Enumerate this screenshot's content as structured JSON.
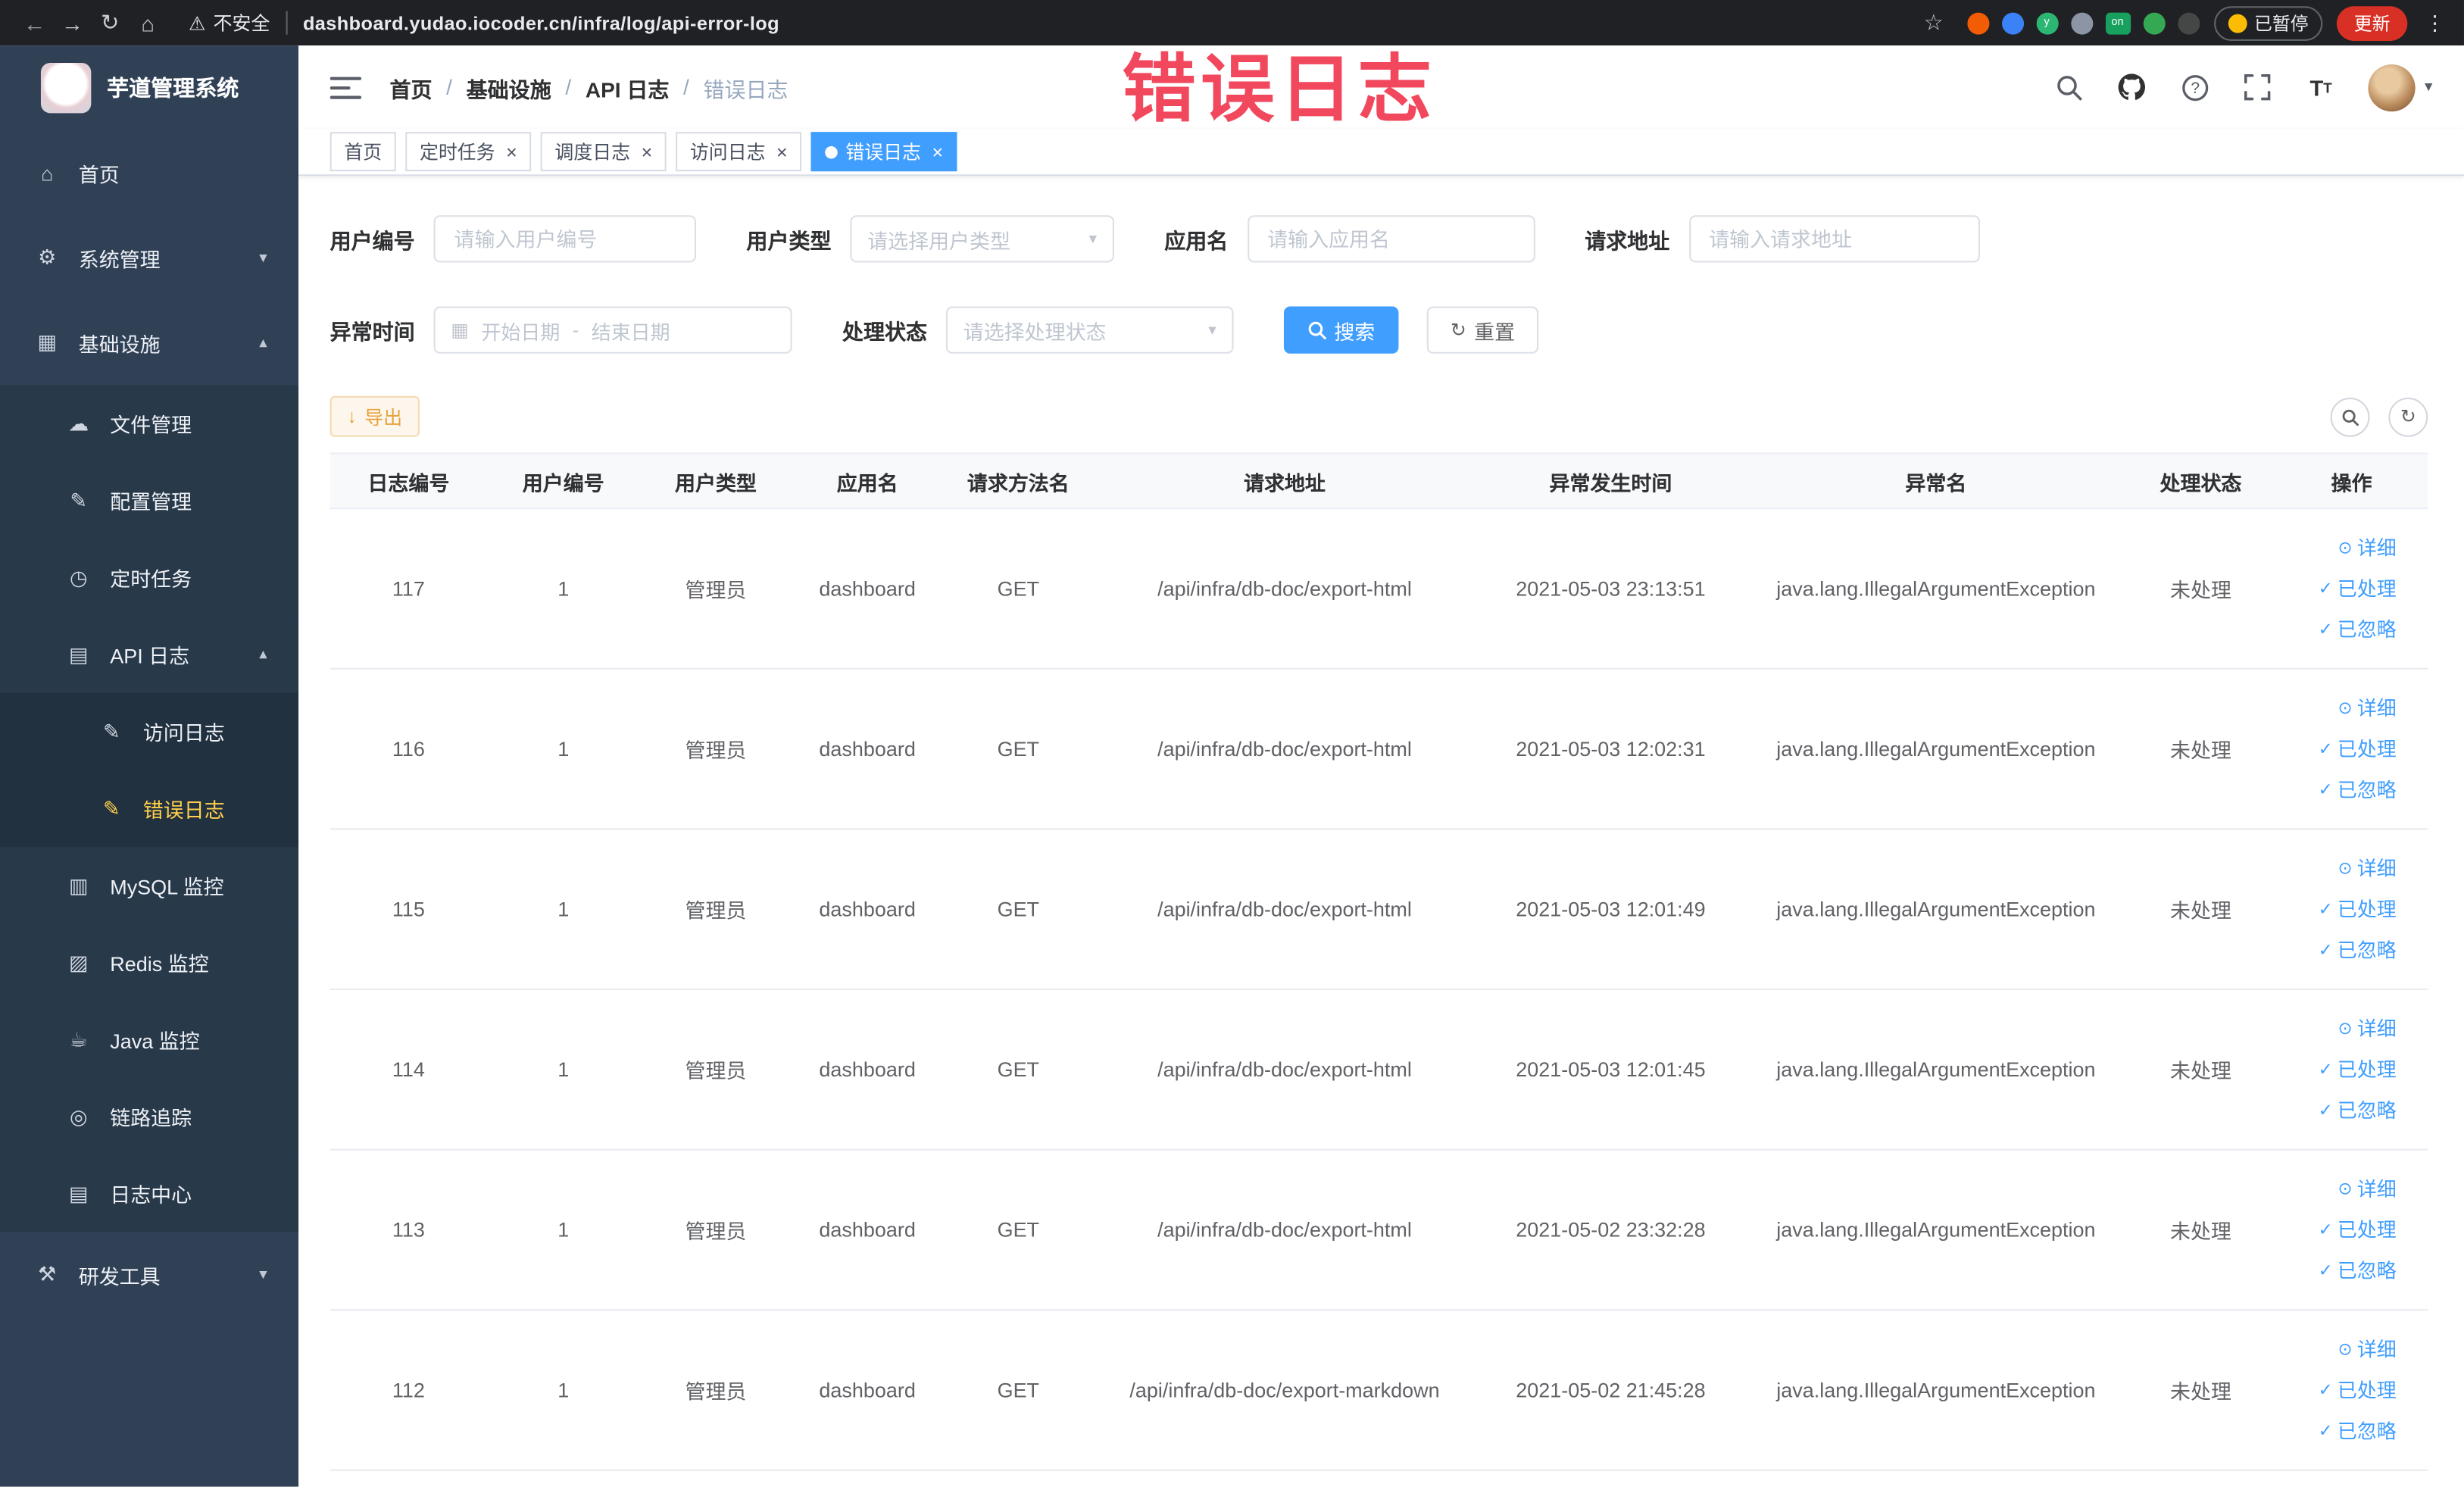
{
  "watermark": "错误日志",
  "icons": {
    "back": "←",
    "forward": "→",
    "reload": "↻",
    "home": "⌂",
    "warning": "⚠",
    "star": "☆",
    "menu_dots": "⋮",
    "close": "×",
    "chevron_down": "▾",
    "chevron_up": "▴",
    "caret_down": "▾",
    "check": "✓",
    "eye": "⊙",
    "calendar": "▦",
    "refresh": "↻",
    "download": "↓"
  },
  "browser": {
    "security_warning": "不安全",
    "url": "dashboard.yudao.iocoder.cn/infra/log/api-error-log",
    "paused_badge": "已暂停",
    "update_button": "更新",
    "extensions": [
      {
        "name": "orange",
        "color": "#f25c05",
        "text": ""
      },
      {
        "name": "blue-drop",
        "color": "#3b82f6",
        "text": ""
      },
      {
        "name": "green-y",
        "color": "#2bb673",
        "text": "y"
      },
      {
        "name": "grid",
        "color": "#8b95a5",
        "text": ""
      },
      {
        "name": "on-badge",
        "color": "#17a05e",
        "text": "on",
        "rect": true
      },
      {
        "name": "leaf",
        "color": "#34a853",
        "text": ""
      },
      {
        "name": "dark",
        "color": "#444746",
        "text": ""
      }
    ]
  },
  "sidebar": {
    "app_title": "芋道管理系统",
    "menu": [
      {
        "key": "home",
        "label": "首页",
        "icon": "home-icon",
        "glyph": "⌂",
        "level": 1
      },
      {
        "key": "system-management",
        "label": "系统管理",
        "icon": "gear-icon",
        "glyph": "⚙",
        "level": 1,
        "expandable": true,
        "expanded": false
      },
      {
        "key": "infrastructure",
        "label": "基础设施",
        "icon": "monitor-icon",
        "glyph": "▦",
        "level": 1,
        "expandable": true,
        "expanded": true
      },
      {
        "key": "file-management",
        "label": "文件管理",
        "icon": "cloud-icon",
        "glyph": "☁",
        "level": 2
      },
      {
        "key": "config-management",
        "label": "配置管理",
        "icon": "edit-icon",
        "glyph": "✎",
        "level": 2
      },
      {
        "key": "cron-job",
        "label": "定时任务",
        "icon": "clock-icon",
        "glyph": "◷",
        "level": 2
      },
      {
        "key": "api-log",
        "label": "API 日志",
        "icon": "log-icon",
        "glyph": "▤",
        "level": 2,
        "expandable": true,
        "expanded": true
      },
      {
        "key": "access-log",
        "label": "访问日志",
        "icon": "document-icon",
        "glyph": "✎",
        "level": 3
      },
      {
        "key": "error-log",
        "label": "错误日志",
        "icon": "document-icon",
        "glyph": "✎",
        "level": 3,
        "active": true
      },
      {
        "key": "mysql-monitor",
        "label": "MySQL 监控",
        "icon": "database-icon",
        "glyph": "▥",
        "level": 2
      },
      {
        "key": "redis-monitor",
        "label": "Redis 监控",
        "icon": "database-icon",
        "glyph": "▨",
        "level": 2
      },
      {
        "key": "java-monitor",
        "label": "Java 监控",
        "icon": "coffee-icon",
        "glyph": "☕",
        "level": 2
      },
      {
        "key": "link-trace",
        "label": "链路追踪",
        "icon": "trace-icon",
        "glyph": "◎",
        "level": 2
      },
      {
        "key": "log-center",
        "label": "日志中心",
        "icon": "log-icon",
        "glyph": "▤",
        "level": 2
      },
      {
        "key": "dev-tools",
        "label": "研发工具",
        "icon": "hammer-icon",
        "glyph": "⚒",
        "level": 1,
        "expandable": true,
        "expanded": false
      }
    ]
  },
  "header": {
    "breadcrumb": [
      "首页",
      "基础设施",
      "API 日志",
      "错误日志"
    ]
  },
  "tabs": [
    {
      "key": "home",
      "label": "首页",
      "closable": false,
      "active": false
    },
    {
      "key": "cron-job",
      "label": "定时任务",
      "closable": true,
      "active": false
    },
    {
      "key": "schedule-log",
      "label": "调度日志",
      "closable": true,
      "active": false
    },
    {
      "key": "access-log",
      "label": "访问日志",
      "closable": true,
      "active": false
    },
    {
      "key": "error-log",
      "label": "错误日志",
      "closable": true,
      "active": true
    }
  ],
  "filters": {
    "user_id_label": "用户编号",
    "user_id_placeholder": "请输入用户编号",
    "user_type_label": "用户类型",
    "user_type_placeholder": "请选择用户类型",
    "app_name_label": "应用名",
    "app_name_placeholder": "请输入应用名",
    "request_url_label": "请求地址",
    "request_url_placeholder": "请输入请求地址",
    "exception_time_label": "异常时间",
    "start_date_placeholder": "开始日期",
    "end_date_placeholder": "结束日期",
    "range_separator": "-",
    "process_status_label": "处理状态",
    "process_status_placeholder": "请选择处理状态",
    "search_button": "搜索",
    "reset_button": "重置"
  },
  "toolbar": {
    "export_button": "导出"
  },
  "table": {
    "columns": [
      "日志编号",
      "用户编号",
      "用户类型",
      "应用名",
      "请求方法名",
      "请求地址",
      "异常发生时间",
      "异常名",
      "处理状态",
      "操作"
    ],
    "rows": [
      [
        "117",
        "1",
        "管理员",
        "dashboard",
        "GET",
        "/api/infra/db-doc/export-html",
        "2021-05-03 23:13:51",
        "java.lang.IllegalArgumentException",
        "未处理"
      ],
      [
        "116",
        "1",
        "管理员",
        "dashboard",
        "GET",
        "/api/infra/db-doc/export-html",
        "2021-05-03 12:02:31",
        "java.lang.IllegalArgumentException",
        "未处理"
      ],
      [
        "115",
        "1",
        "管理员",
        "dashboard",
        "GET",
        "/api/infra/db-doc/export-html",
        "2021-05-03 12:01:49",
        "java.lang.IllegalArgumentException",
        "未处理"
      ],
      [
        "114",
        "1",
        "管理员",
        "dashboard",
        "GET",
        "/api/infra/db-doc/export-html",
        "2021-05-03 12:01:45",
        "java.lang.IllegalArgumentException",
        "未处理"
      ],
      [
        "113",
        "1",
        "管理员",
        "dashboard",
        "GET",
        "/api/infra/db-doc/export-html",
        "2021-05-02 23:32:28",
        "java.lang.IllegalArgumentException",
        "未处理"
      ],
      [
        "112",
        "1",
        "管理员",
        "dashboard",
        "GET",
        "/api/infra/db-doc/export-markdown",
        "2021-05-02 21:45:28",
        "java.lang.IllegalArgumentException",
        "未处理"
      ]
    ],
    "actions": [
      {
        "key": "detail",
        "label": "详细",
        "icon": "eye",
        "icon_name": "eye-icon"
      },
      {
        "key": "mark-processed",
        "label": "已处理",
        "icon": "check",
        "icon_name": "check-icon"
      },
      {
        "key": "mark-ignored",
        "label": "已忽略",
        "icon": "check",
        "icon_name": "check-icon"
      }
    ],
    "status_colors": {
      "accent": "#409eff"
    }
  }
}
